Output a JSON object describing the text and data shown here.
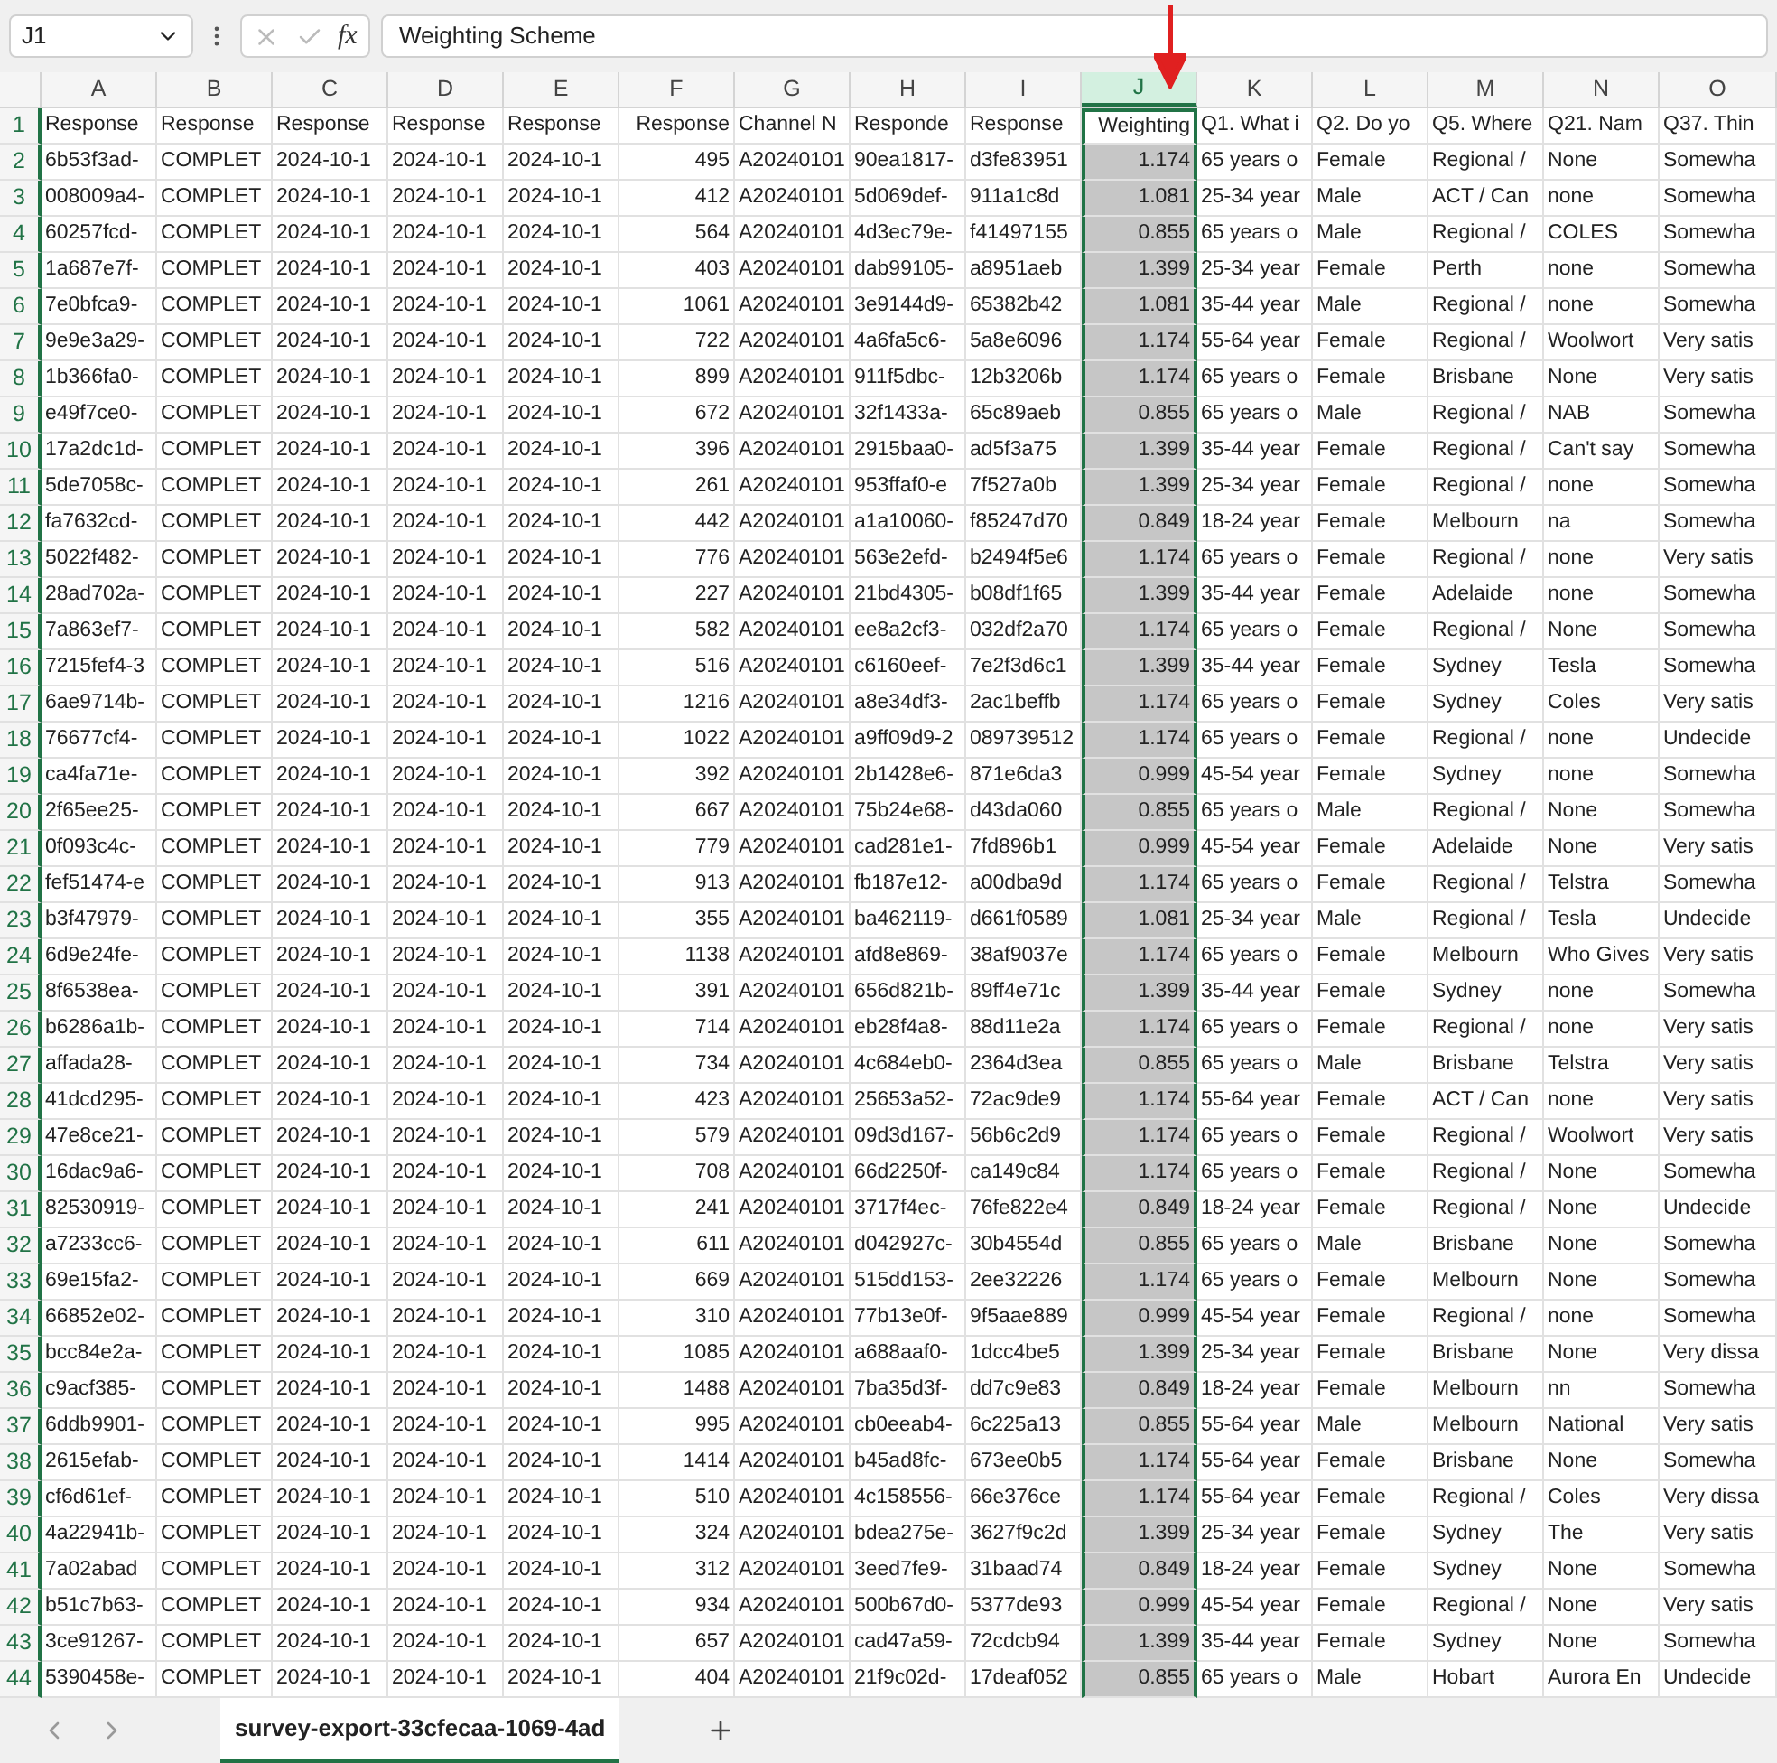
{
  "name_box": "J1",
  "formula_bar": {
    "fx": "fx",
    "value": "Weighting Scheme"
  },
  "columns": [
    {
      "letter": "A",
      "selected": false,
      "kind": "text"
    },
    {
      "letter": "B",
      "selected": false,
      "kind": "text"
    },
    {
      "letter": "C",
      "selected": false,
      "kind": "text"
    },
    {
      "letter": "D",
      "selected": false,
      "kind": "text"
    },
    {
      "letter": "E",
      "selected": false,
      "kind": "text"
    },
    {
      "letter": "F",
      "selected": false,
      "kind": "number"
    },
    {
      "letter": "G",
      "selected": false,
      "kind": "text"
    },
    {
      "letter": "H",
      "selected": false,
      "kind": "text"
    },
    {
      "letter": "I",
      "selected": false,
      "kind": "text"
    },
    {
      "letter": "J",
      "selected": true,
      "kind": "number"
    },
    {
      "letter": "K",
      "selected": false,
      "kind": "text"
    },
    {
      "letter": "L",
      "selected": false,
      "kind": "text"
    },
    {
      "letter": "M",
      "selected": false,
      "kind": "text"
    },
    {
      "letter": "N",
      "selected": false,
      "kind": "text"
    },
    {
      "letter": "O",
      "selected": false,
      "kind": "text"
    }
  ],
  "rows": [
    {
      "number": "1",
      "active": true,
      "cells": [
        "Response",
        "Response",
        "Response",
        "Response",
        "Response",
        "Response",
        "Channel N",
        "Responde",
        "Response",
        "Weighting",
        "Q1. What i",
        "Q2. Do yo",
        "Q5. Where",
        "Q21. Nam",
        "Q37. Thin"
      ]
    },
    {
      "number": "2",
      "active": false,
      "cells": [
        "6b53f3ad-",
        "COMPLET",
        "2024-10-1",
        "2024-10-1",
        "2024-10-1",
        "495",
        "A20240101",
        "90ea1817-",
        "d3fe83951",
        "1.174",
        "65 years o",
        "Female",
        "Regional /",
        "None",
        "Somewha"
      ]
    },
    {
      "number": "3",
      "active": false,
      "cells": [
        "008009a4-",
        "COMPLET",
        "2024-10-1",
        "2024-10-1",
        "2024-10-1",
        "412",
        "A20240101",
        "5d069def-",
        "911a1c8d",
        "1.081",
        "25-34 year",
        "Male",
        "ACT / Can",
        "none",
        "Somewha"
      ]
    },
    {
      "number": "4",
      "active": false,
      "cells": [
        "60257fcd-",
        "COMPLET",
        "2024-10-1",
        "2024-10-1",
        "2024-10-1",
        "564",
        "A20240101",
        "4d3ec79e-",
        "f41497155",
        "0.855",
        "65 years o",
        "Male",
        "Regional /",
        "COLES",
        "Somewha"
      ]
    },
    {
      "number": "5",
      "active": false,
      "cells": [
        "1a687e7f-",
        "COMPLET",
        "2024-10-1",
        "2024-10-1",
        "2024-10-1",
        "403",
        "A20240101",
        "dab99105-",
        "a8951aeb",
        "1.399",
        "25-34 year",
        "Female",
        "Perth",
        "none",
        "Somewha"
      ]
    },
    {
      "number": "6",
      "active": false,
      "cells": [
        "7e0bfca9-",
        "COMPLET",
        "2024-10-1",
        "2024-10-1",
        "2024-10-1",
        "1061",
        "A20240101",
        "3e9144d9-",
        "65382b42",
        "1.081",
        "35-44 year",
        "Male",
        "Regional /",
        "none",
        "Somewha"
      ]
    },
    {
      "number": "7",
      "active": false,
      "cells": [
        "9e9e3a29-",
        "COMPLET",
        "2024-10-1",
        "2024-10-1",
        "2024-10-1",
        "722",
        "A20240101",
        "4a6fa5c6-",
        "5a8e6096",
        "1.174",
        "55-64 year",
        "Female",
        "Regional /",
        "Woolwort",
        "Very satis"
      ]
    },
    {
      "number": "8",
      "active": false,
      "cells": [
        "1b366fa0-",
        "COMPLET",
        "2024-10-1",
        "2024-10-1",
        "2024-10-1",
        "899",
        "A20240101",
        "911f5dbc-",
        "12b3206b",
        "1.174",
        "65 years o",
        "Female",
        "Brisbane",
        "None",
        "Very satis"
      ]
    },
    {
      "number": "9",
      "active": false,
      "cells": [
        "e49f7ce0-",
        "COMPLET",
        "2024-10-1",
        "2024-10-1",
        "2024-10-1",
        "672",
        "A20240101",
        "32f1433a-",
        "65c89aeb",
        "0.855",
        "65 years o",
        "Male",
        "Regional /",
        "NAB",
        "Somewha"
      ]
    },
    {
      "number": "10",
      "active": false,
      "cells": [
        "17a2dc1d-",
        "COMPLET",
        "2024-10-1",
        "2024-10-1",
        "2024-10-1",
        "396",
        "A20240101",
        "2915baa0-",
        "ad5f3a75",
        "1.399",
        "35-44 year",
        "Female",
        "Regional /",
        "Can't say",
        "Somewha"
      ]
    },
    {
      "number": "11",
      "active": false,
      "cells": [
        "5de7058c-",
        "COMPLET",
        "2024-10-1",
        "2024-10-1",
        "2024-10-1",
        "261",
        "A20240101",
        "953ffaf0-e",
        "7f527a0b",
        "1.399",
        "25-34 year",
        "Female",
        "Regional /",
        "none",
        "Somewha"
      ]
    },
    {
      "number": "12",
      "active": false,
      "cells": [
        "fa7632cd-",
        "COMPLET",
        "2024-10-1",
        "2024-10-1",
        "2024-10-1",
        "442",
        "A20240101",
        "a1a10060-",
        "f85247d70",
        "0.849",
        "18-24 year",
        "Female",
        "Melbourn",
        "na",
        "Somewha"
      ]
    },
    {
      "number": "13",
      "active": false,
      "cells": [
        "5022f482-",
        "COMPLET",
        "2024-10-1",
        "2024-10-1",
        "2024-10-1",
        "776",
        "A20240101",
        "563e2efd-",
        "b2494f5e6",
        "1.174",
        "65 years o",
        "Female",
        "Regional /",
        "none",
        "Very satis"
      ]
    },
    {
      "number": "14",
      "active": false,
      "cells": [
        "28ad702a-",
        "COMPLET",
        "2024-10-1",
        "2024-10-1",
        "2024-10-1",
        "227",
        "A20240101",
        "21bd4305-",
        "b08df1f65",
        "1.399",
        "35-44 year",
        "Female",
        "Adelaide",
        "none",
        "Somewha"
      ]
    },
    {
      "number": "15",
      "active": false,
      "cells": [
        "7a863ef7-",
        "COMPLET",
        "2024-10-1",
        "2024-10-1",
        "2024-10-1",
        "582",
        "A20240101",
        "ee8a2cf3-",
        "032df2a70",
        "1.174",
        "65 years o",
        "Female",
        "Regional /",
        "None",
        "Somewha"
      ]
    },
    {
      "number": "16",
      "active": false,
      "cells": [
        "7215fef4-3",
        "COMPLET",
        "2024-10-1",
        "2024-10-1",
        "2024-10-1",
        "516",
        "A20240101",
        "c6160eef-",
        "7e2f3d6c1",
        "1.399",
        "35-44 year",
        "Female",
        "Sydney",
        "Tesla",
        "Somewha"
      ]
    },
    {
      "number": "17",
      "active": false,
      "cells": [
        "6ae9714b-",
        "COMPLET",
        "2024-10-1",
        "2024-10-1",
        "2024-10-1",
        "1216",
        "A20240101",
        "a8e34df3-",
        "2ac1beffb",
        "1.174",
        "65 years o",
        "Female",
        "Sydney",
        "Coles",
        "Very satis"
      ]
    },
    {
      "number": "18",
      "active": false,
      "cells": [
        "76677cf4-",
        "COMPLET",
        "2024-10-1",
        "2024-10-1",
        "2024-10-1",
        "1022",
        "A20240101",
        "a9ff09d9-2",
        "089739512",
        "1.174",
        "65 years o",
        "Female",
        "Regional /",
        "none",
        "Undecide"
      ]
    },
    {
      "number": "19",
      "active": false,
      "cells": [
        "ca4fa71e-",
        "COMPLET",
        "2024-10-1",
        "2024-10-1",
        "2024-10-1",
        "392",
        "A20240101",
        "2b1428e6-",
        "871e6da3",
        "0.999",
        "45-54 year",
        "Female",
        "Sydney",
        "none",
        "Somewha"
      ]
    },
    {
      "number": "20",
      "active": false,
      "cells": [
        "2f65ee25-",
        "COMPLET",
        "2024-10-1",
        "2024-10-1",
        "2024-10-1",
        "667",
        "A20240101",
        "75b24e68-",
        "d43da060",
        "0.855",
        "65 years o",
        "Male",
        "Regional /",
        "None",
        "Somewha"
      ]
    },
    {
      "number": "21",
      "active": false,
      "cells": [
        "0f093c4c-",
        "COMPLET",
        "2024-10-1",
        "2024-10-1",
        "2024-10-1",
        "779",
        "A20240101",
        "cad281e1-",
        "7fd896b1",
        "0.999",
        "45-54 year",
        "Female",
        "Adelaide",
        "None",
        "Very satis"
      ]
    },
    {
      "number": "22",
      "active": false,
      "cells": [
        "fef51474-e",
        "COMPLET",
        "2024-10-1",
        "2024-10-1",
        "2024-10-1",
        "913",
        "A20240101",
        "fb187e12-",
        "a00dba9d",
        "1.174",
        "65 years o",
        "Female",
        "Regional /",
        "Telstra",
        "Somewha"
      ]
    },
    {
      "number": "23",
      "active": false,
      "cells": [
        "b3f47979-",
        "COMPLET",
        "2024-10-1",
        "2024-10-1",
        "2024-10-1",
        "355",
        "A20240101",
        "ba462119-",
        "d661f0589",
        "1.081",
        "25-34 year",
        "Male",
        "Regional /",
        "Tesla",
        "Undecide"
      ]
    },
    {
      "number": "24",
      "active": false,
      "cells": [
        "6d9e24fe-",
        "COMPLET",
        "2024-10-1",
        "2024-10-1",
        "2024-10-1",
        "1138",
        "A20240101",
        "afd8e869-",
        "38af9037e",
        "1.174",
        "65 years o",
        "Female",
        "Melbourn",
        "Who Gives",
        "Very satis"
      ]
    },
    {
      "number": "25",
      "active": false,
      "cells": [
        "8f6538ea-",
        "COMPLET",
        "2024-10-1",
        "2024-10-1",
        "2024-10-1",
        "391",
        "A20240101",
        "656d821b-",
        "89ff4e71c",
        "1.399",
        "35-44 year",
        "Female",
        "Sydney",
        "none",
        "Somewha"
      ]
    },
    {
      "number": "26",
      "active": false,
      "cells": [
        "b6286a1b-",
        "COMPLET",
        "2024-10-1",
        "2024-10-1",
        "2024-10-1",
        "714",
        "A20240101",
        "eb28f4a8-",
        "88d11e2a",
        "1.174",
        "65 years o",
        "Female",
        "Regional /",
        "none",
        "Very satis"
      ]
    },
    {
      "number": "27",
      "active": false,
      "cells": [
        "affada28-",
        "COMPLET",
        "2024-10-1",
        "2024-10-1",
        "2024-10-1",
        "734",
        "A20240101",
        "4c684eb0-",
        "2364d3ea",
        "0.855",
        "65 years o",
        "Male",
        "Brisbane",
        "Telstra",
        "Very satis"
      ]
    },
    {
      "number": "28",
      "active": false,
      "cells": [
        "41dcd295-",
        "COMPLET",
        "2024-10-1",
        "2024-10-1",
        "2024-10-1",
        "423",
        "A20240101",
        "25653a52-",
        "72ac9de9",
        "1.174",
        "55-64 year",
        "Female",
        "ACT / Can",
        "none",
        "Very satis"
      ]
    },
    {
      "number": "29",
      "active": false,
      "cells": [
        "47e8ce21-",
        "COMPLET",
        "2024-10-1",
        "2024-10-1",
        "2024-10-1",
        "579",
        "A20240101",
        "09d3d167-",
        "56b6c2d9",
        "1.174",
        "65 years o",
        "Female",
        "Regional /",
        "Woolwort",
        "Very satis"
      ]
    },
    {
      "number": "30",
      "active": false,
      "cells": [
        "16dac9a6-",
        "COMPLET",
        "2024-10-1",
        "2024-10-1",
        "2024-10-1",
        "708",
        "A20240101",
        "66d2250f-",
        "ca149c84",
        "1.174",
        "65 years o",
        "Female",
        "Regional /",
        "None",
        "Somewha"
      ]
    },
    {
      "number": "31",
      "active": false,
      "cells": [
        "82530919-",
        "COMPLET",
        "2024-10-1",
        "2024-10-1",
        "2024-10-1",
        "241",
        "A20240101",
        "3717f4ec-",
        "76fe822e4",
        "0.849",
        "18-24 year",
        "Female",
        "Regional /",
        "None",
        "Undecide"
      ]
    },
    {
      "number": "32",
      "active": false,
      "cells": [
        "a7233cc6-",
        "COMPLET",
        "2024-10-1",
        "2024-10-1",
        "2024-10-1",
        "611",
        "A20240101",
        "d042927c-",
        "30b4554d",
        "0.855",
        "65 years o",
        "Male",
        "Brisbane",
        "None",
        "Somewha"
      ]
    },
    {
      "number": "33",
      "active": false,
      "cells": [
        "69e15fa2-",
        "COMPLET",
        "2024-10-1",
        "2024-10-1",
        "2024-10-1",
        "669",
        "A20240101",
        "515dd153-",
        "2ee32226",
        "1.174",
        "65 years o",
        "Female",
        "Melbourn",
        "None",
        "Somewha"
      ]
    },
    {
      "number": "34",
      "active": false,
      "cells": [
        "66852e02-",
        "COMPLET",
        "2024-10-1",
        "2024-10-1",
        "2024-10-1",
        "310",
        "A20240101",
        "77b13e0f-",
        "9f5aae889",
        "0.999",
        "45-54 year",
        "Female",
        "Regional /",
        "none",
        "Somewha"
      ]
    },
    {
      "number": "35",
      "active": false,
      "cells": [
        "bcc84e2a-",
        "COMPLET",
        "2024-10-1",
        "2024-10-1",
        "2024-10-1",
        "1085",
        "A20240101",
        "a688aaf0-",
        "1dcc4be5",
        "1.399",
        "25-34 year",
        "Female",
        "Brisbane",
        "None",
        "Very dissa"
      ]
    },
    {
      "number": "36",
      "active": false,
      "cells": [
        "c9acf385-",
        "COMPLET",
        "2024-10-1",
        "2024-10-1",
        "2024-10-1",
        "1488",
        "A20240101",
        "7ba35d3f-",
        "dd7c9e83",
        "0.849",
        "18-24 year",
        "Female",
        "Melbourn",
        "nn",
        "Somewha"
      ]
    },
    {
      "number": "37",
      "active": false,
      "cells": [
        "6ddb9901-",
        "COMPLET",
        "2024-10-1",
        "2024-10-1",
        "2024-10-1",
        "995",
        "A20240101",
        "cb0eeab4-",
        "6c225a13",
        "0.855",
        "55-64 year",
        "Male",
        "Melbourn",
        "National",
        "Very satis"
      ]
    },
    {
      "number": "38",
      "active": false,
      "cells": [
        "2615efab-",
        "COMPLET",
        "2024-10-1",
        "2024-10-1",
        "2024-10-1",
        "1414",
        "A20240101",
        "b45ad8fc-",
        "673ee0b5",
        "1.174",
        "55-64 year",
        "Female",
        "Brisbane",
        "None",
        "Somewha"
      ]
    },
    {
      "number": "39",
      "active": false,
      "cells": [
        "cf6d61ef-",
        "COMPLET",
        "2024-10-1",
        "2024-10-1",
        "2024-10-1",
        "510",
        "A20240101",
        "4c158556-",
        "66e376ce",
        "1.174",
        "55-64 year",
        "Female",
        "Regional /",
        "Coles",
        "Very dissa"
      ]
    },
    {
      "number": "40",
      "active": false,
      "cells": [
        "4a22941b-",
        "COMPLET",
        "2024-10-1",
        "2024-10-1",
        "2024-10-1",
        "324",
        "A20240101",
        "bdea275e-",
        "3627f9c2d",
        "1.399",
        "25-34 year",
        "Female",
        "Sydney",
        "The",
        "Very satis"
      ]
    },
    {
      "number": "41",
      "active": false,
      "cells": [
        "7a02abad",
        "COMPLET",
        "2024-10-1",
        "2024-10-1",
        "2024-10-1",
        "312",
        "A20240101",
        "3eed7fe9-",
        "31baad74",
        "0.849",
        "18-24 year",
        "Female",
        "Sydney",
        "None",
        "Somewha"
      ]
    },
    {
      "number": "42",
      "active": false,
      "cells": [
        "b51c7b63-",
        "COMPLET",
        "2024-10-1",
        "2024-10-1",
        "2024-10-1",
        "934",
        "A20240101",
        "500b67d0-",
        "5377de93",
        "0.999",
        "45-54 year",
        "Female",
        "Regional /",
        "None",
        "Very satis"
      ]
    },
    {
      "number": "43",
      "active": false,
      "cells": [
        "3ce91267-",
        "COMPLET",
        "2024-10-1",
        "2024-10-1",
        "2024-10-1",
        "657",
        "A20240101",
        "cad47a59-",
        "72cdcb94",
        "1.399",
        "35-44 year",
        "Female",
        "Sydney",
        "None",
        "Somewha"
      ]
    },
    {
      "number": "44",
      "active": false,
      "cells": [
        "5390458e-",
        "COMPLET",
        "2024-10-1",
        "2024-10-1",
        "2024-10-1",
        "404",
        "A20240101",
        "21f9c02d-",
        "17deaf052",
        "0.855",
        "65 years o",
        "Male",
        "Hobart",
        "Aurora En",
        "Undecide"
      ]
    }
  ],
  "sheet_tabs": [
    {
      "label": "survey-export-33cfecaa-1069-4ad",
      "selected": true
    }
  ]
}
